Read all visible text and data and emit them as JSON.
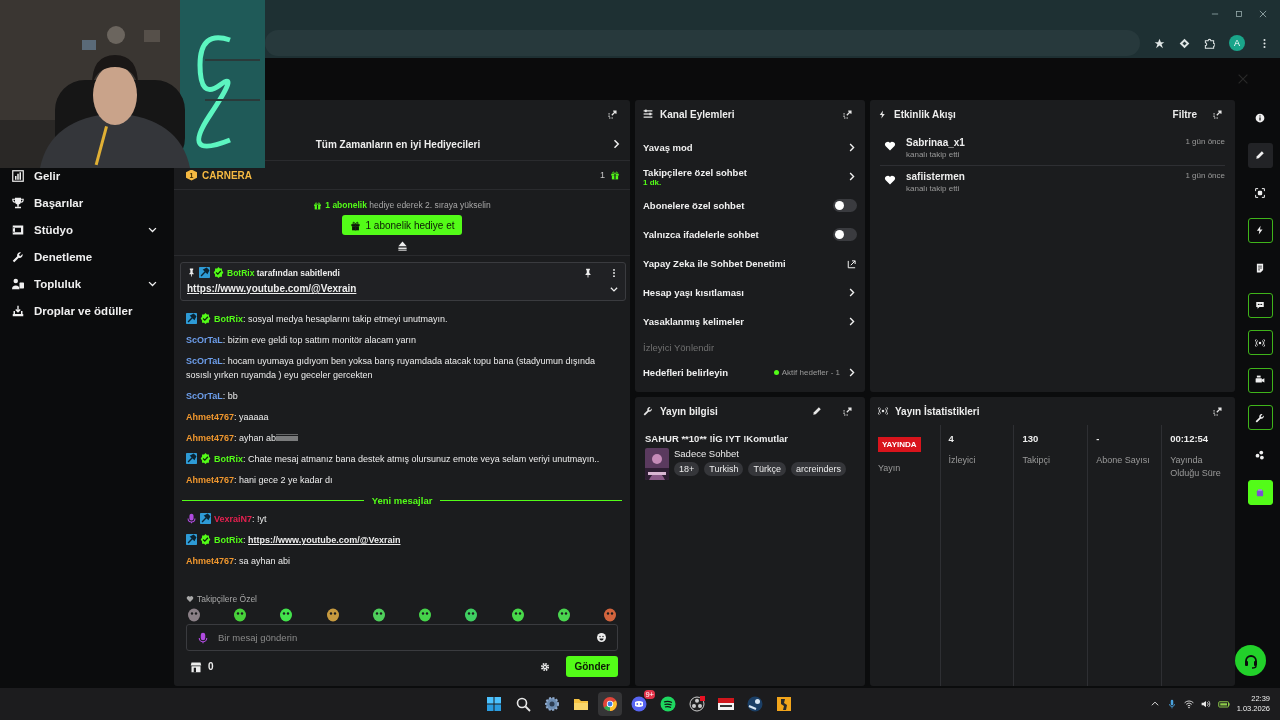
{
  "browser": {
    "avatar": "A"
  },
  "sidebar": {
    "items": [
      {
        "label": "Gelir",
        "kind": "link"
      },
      {
        "label": "Başarılar",
        "kind": "link"
      },
      {
        "label": "Stüdyo",
        "kind": "group"
      },
      {
        "label": "Denetleme",
        "kind": "link"
      },
      {
        "label": "Topluluk",
        "kind": "group"
      },
      {
        "label": "Droplar ve ödüller",
        "kind": "link"
      }
    ]
  },
  "chat": {
    "top_gifters": "Tüm Zamanların en iyi Hediyecileri",
    "leader": {
      "rank": "1",
      "name": "CARNERA",
      "count": "1"
    },
    "gift_prompt": {
      "highlight": "1 abonelik",
      "rest": "hediye ederek 2. sıraya yükselin"
    },
    "gift_button": "1 abonelik hediye et",
    "pinned": {
      "by": "BotRix",
      "note": "tarafından sabitlendi",
      "link": "https://www.youtube.com/@Vexrain"
    },
    "messages": [
      {
        "mod": true,
        "verified": true,
        "user": "BotRix",
        "color": "#53fc18",
        "text": ": sosyal medya hesaplarını takip etmeyi unutmayın."
      },
      {
        "user": "ScOrTaL",
        "color": "#6d9eeb",
        "text": ": bizim eve geldi top sattım monitör alacam yarın"
      },
      {
        "user": "ScOrTaL",
        "color": "#6d9eeb",
        "text": ": hocam uyumaya gıdıyom ben yoksa barış ruyamdada atacak topu bana (stadyumun dışında sosıslı yırken ruyamda ) eyu geceler gercekten"
      },
      {
        "user": "ScOrTaL",
        "color": "#6d9eeb",
        "text": ": bb"
      },
      {
        "user": "Ahmet4767",
        "color": "#f0972e",
        "text": ": yaaaaa"
      },
      {
        "user": "Ahmet4767",
        "color": "#f0972e",
        "text": ": ayhan abiiiiiiiiiii"
      },
      {
        "mod": true,
        "verified": true,
        "user": "BotRix",
        "color": "#53fc18",
        "text": ": Chate mesaj atmanız bana destek atmış olursunuz emote veya selam veriyi unutmayın.."
      },
      {
        "user": "Ahmet4767",
        "color": "#f0972e",
        "text": ": hani gece 2 ye kadar dı"
      }
    ],
    "new_divider": "Yeni mesajlar",
    "new_messages": [
      {
        "mic": true,
        "mod": true,
        "user": "VexraiN7",
        "color": "#e3204f",
        "text": ": !yt"
      },
      {
        "mod": true,
        "verified": true,
        "user": "BotRix",
        "color": "#53fc18",
        "text": ": ",
        "link": "https://www.youtube.com/@Vexrain"
      },
      {
        "user": "Ahmet4767",
        "color": "#f0972e",
        "text": ": sa ayhan abi"
      }
    ],
    "emotes_label": "Takipçilere Özel",
    "input": {
      "placeholder": "Bir mesaj gönderin"
    },
    "points": "0",
    "send_button": "Gönder"
  },
  "channel_actions": {
    "title": "Kanal Eylemleri",
    "items": [
      {
        "kind": "chevron",
        "label": "Yavaş mod"
      },
      {
        "kind": "chevron",
        "label": "Takipçilere özel sohbet",
        "sub": "1 dk."
      },
      {
        "kind": "toggle",
        "label": "Abonelere özel sohbet",
        "on": false
      },
      {
        "kind": "toggle",
        "label": "Yalnızca ifadelerle sohbet",
        "on": false
      },
      {
        "kind": "external",
        "label": "Yapay Zeka ile Sohbet Denetimi"
      },
      {
        "kind": "chevron",
        "label": "Hesap yaşı kısıtlaması"
      },
      {
        "kind": "chevron",
        "label": "Yasaklanmış kelimeler"
      },
      {
        "kind": "section",
        "label": "İzleyici Yönlendir"
      },
      {
        "kind": "goal",
        "label": "Hedefleri belirleyin",
        "status": "Aktif hedefler - 1"
      }
    ]
  },
  "activity": {
    "title": "Etkinlik Akışı",
    "filter": "Filtre",
    "events": [
      {
        "name": "Sabrinaa_x1",
        "action": "kanalı takip etti",
        "time": "1 gün önce"
      },
      {
        "name": "safiistermen",
        "action": "kanalı takip etti",
        "time": "1 gün önce"
      }
    ]
  },
  "stream_info": {
    "title": "Yayın bilgisi",
    "stream_title": "SAHUR **10** !İG !YT !Komutlar",
    "category": "Sadece Sohbet",
    "tags": [
      "18+",
      "Turkish",
      "Türkçe",
      "arcreinders"
    ]
  },
  "stream_stats": {
    "title": "Yayın İstatistikleri",
    "live": "YAYINDA",
    "live_label": "Yayın",
    "stats": [
      {
        "value": "4",
        "label": "İzleyici"
      },
      {
        "value": "130",
        "label": "Takipçi"
      },
      {
        "value": "-",
        "label": "Abone Sayısı"
      },
      {
        "value": "00:12:54",
        "label": "Yayında Olduğu Süre"
      }
    ]
  },
  "rail": [
    {
      "kind": "tool",
      "on": false,
      "selected": false
    },
    {
      "kind": "tool",
      "on": false,
      "selected": true
    },
    {
      "kind": "tool",
      "on": false,
      "selected": false
    },
    {
      "kind": "tool",
      "on": true,
      "selected": false
    },
    {
      "kind": "tool",
      "on": false,
      "selected": false
    },
    {
      "kind": "tool",
      "on": true,
      "selected": false
    },
    {
      "kind": "tool",
      "on": true,
      "selected": false
    },
    {
      "kind": "tool",
      "on": true,
      "selected": false
    },
    {
      "kind": "tool",
      "on": true,
      "selected": false
    },
    {
      "kind": "tool",
      "on": false,
      "selected": false
    },
    {
      "kind": "app",
      "on": true,
      "selected": false
    }
  ],
  "taskbar": {
    "apps": [
      {
        "selected": false
      },
      {
        "selected": false
      },
      {
        "selected": false
      },
      {
        "selected": false
      },
      {
        "selected": true
      },
      {
        "selected": false,
        "badge": "9+"
      },
      {
        "selected": false
      },
      {
        "selected": false
      },
      {
        "selected": false
      },
      {
        "selected": false
      },
      {
        "selected": false
      }
    ],
    "time": "22:39",
    "date": "1.03.2026"
  }
}
